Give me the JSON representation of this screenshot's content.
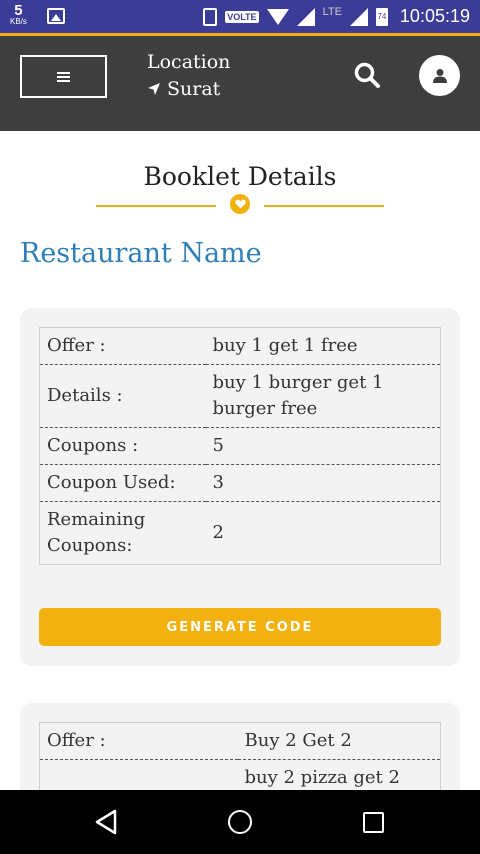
{
  "status_bar": {
    "speed_value": "5",
    "speed_unit": "KB/s",
    "volte": "VOLTE",
    "lte": "LTE",
    "battery": "74",
    "time": "10:05:19"
  },
  "header": {
    "location_label": "Location",
    "city": "Surat"
  },
  "page": {
    "title": "Booklet Details",
    "restaurant_name": "Restaurant Name"
  },
  "booklets": [
    {
      "rows": [
        {
          "label": "Offer :",
          "value": "buy 1 get 1 free"
        },
        {
          "label": "Details :",
          "value": "buy 1 burger get 1 burger free"
        },
        {
          "label": "Coupons :",
          "value": "5"
        },
        {
          "label": "Coupon Used:",
          "value": "3"
        },
        {
          "label": "Remaining Coupons:",
          "value": "2"
        }
      ],
      "button_label": "GENERATE CODE"
    },
    {
      "rows": [
        {
          "label": "Offer :",
          "value": "Buy 2 Get 2"
        },
        {
          "label": "",
          "value": "buy 2 pizza get 2"
        }
      ]
    }
  ],
  "colors": {
    "status_bar": "#3b3b98",
    "header": "#3e3e3e",
    "accent": "#f2b10f",
    "restaurant_name": "#2e7fb8"
  }
}
